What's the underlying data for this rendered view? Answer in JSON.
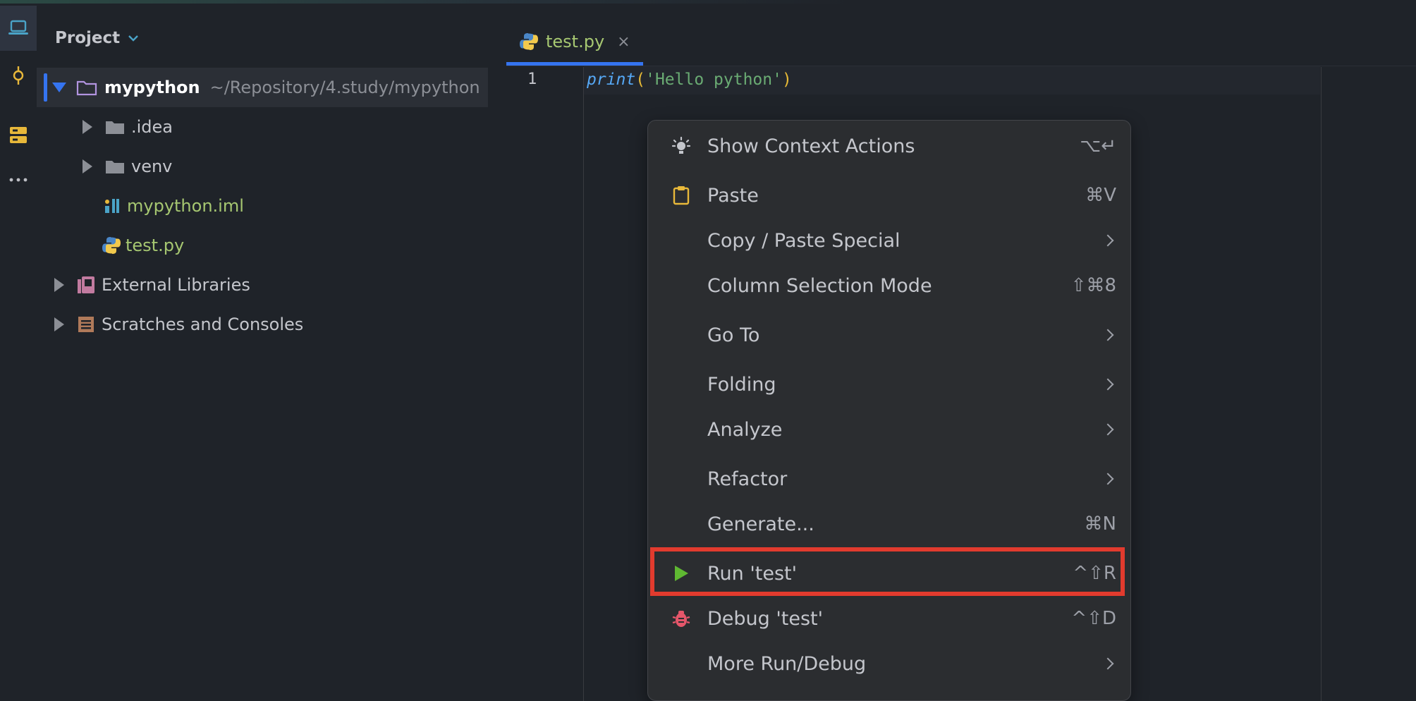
{
  "sidebar": {
    "tools": [
      {
        "name": "project-tool",
        "icon": "laptop-icon"
      },
      {
        "name": "commit-tool",
        "icon": "commit-icon"
      },
      {
        "name": "structure-tool",
        "icon": "structure-icon"
      },
      {
        "name": "more-tool",
        "icon": "more-icon",
        "label": "⋮"
      }
    ]
  },
  "project_panel": {
    "title": "Project",
    "tree": [
      {
        "label": "mypython",
        "path": "~/Repository/4.study/mypython",
        "expanded": true,
        "icon": "folder-icon"
      },
      {
        "label": ".idea",
        "icon": "folder-icon",
        "expanded": false
      },
      {
        "label": "venv",
        "icon": "folder-icon",
        "expanded": false
      },
      {
        "label": "mypython.iml",
        "icon": "iml-file-icon"
      },
      {
        "label": "test.py",
        "icon": "python-file-icon"
      },
      {
        "label": "External Libraries",
        "icon": "library-icon",
        "expanded": false
      },
      {
        "label": "Scratches and Consoles",
        "icon": "scratches-icon",
        "expanded": false
      }
    ]
  },
  "editor": {
    "tab": {
      "label": "test.py",
      "close": "×"
    },
    "lines": [
      {
        "number": "1",
        "fn": "print",
        "open": "(",
        "string": "'Hello python'",
        "close": ")"
      }
    ]
  },
  "context_menu": {
    "items": [
      {
        "label": "Show Context Actions",
        "shortcut": "⌥↵",
        "icon": "bulb-icon"
      },
      {
        "label": "Paste",
        "shortcut": "⌘V",
        "icon": "clipboard-icon"
      },
      {
        "label": "Copy / Paste Special",
        "submenu": true
      },
      {
        "label": "Column Selection Mode",
        "shortcut": "⇧⌘8"
      },
      {
        "label": "Go To",
        "submenu": true
      },
      {
        "label": "Folding",
        "submenu": true
      },
      {
        "label": "Analyze",
        "submenu": true
      },
      {
        "label": "Refactor",
        "submenu": true
      },
      {
        "label": "Generate...",
        "shortcut": "⌘N"
      },
      {
        "label": "Run 'test'",
        "shortcut": "^⇧R",
        "icon": "run-icon",
        "highlighted": true
      },
      {
        "label": "Debug 'test'",
        "shortcut": "^⇧D",
        "icon": "bug-icon"
      },
      {
        "label": "More Run/Debug",
        "submenu": true
      }
    ]
  },
  "colors": {
    "accent": "#3574f0",
    "highlight_box": "#e23b2e",
    "run_green": "#5fb832",
    "debug_red": "#e5566a"
  }
}
